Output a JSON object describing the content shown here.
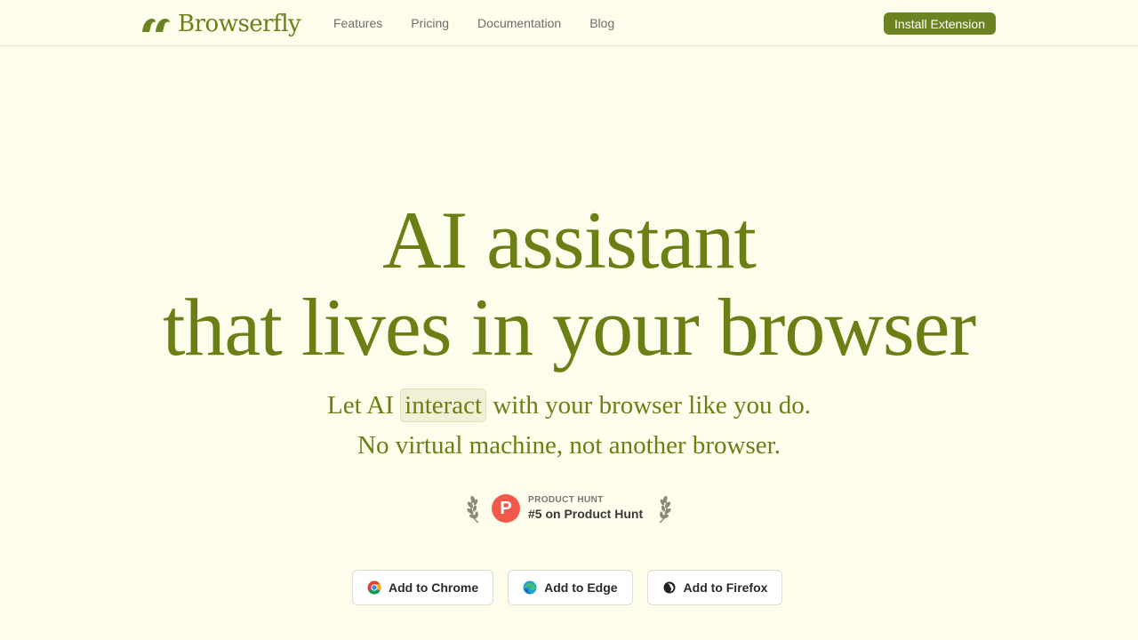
{
  "nav": {
    "brand": {
      "name": "Browserfly",
      "logo_icon": "browserfly-logo-icon"
    },
    "links": [
      {
        "label": "Features"
      },
      {
        "label": "Pricing"
      },
      {
        "label": "Documentation"
      },
      {
        "label": "Blog"
      }
    ],
    "install_label": "Install Extension"
  },
  "hero": {
    "title_line_1": "AI assistant",
    "title_line_2": "that lives in your browser",
    "subtitle_prefix": "Let AI ",
    "subtitle_highlight": "interact",
    "subtitle_suffix": " with your browser like you do.",
    "subtitle_line_2": "No virtual machine, not another browser."
  },
  "badge": {
    "logo_letter": "P",
    "kicker": "PRODUCT HUNT",
    "title": "#5 on Product Hunt"
  },
  "store_buttons": [
    {
      "label": "Add to Chrome",
      "icon": "chrome-icon"
    },
    {
      "label": "Add to Edge",
      "icon": "edge-icon"
    },
    {
      "label": "Add to Firefox",
      "icon": "firefox-icon"
    }
  ],
  "colors": {
    "background": "#fefdec",
    "brand_green": "#6b7f14",
    "button_green": "#6b8321",
    "product_hunt_red": "#f0594a"
  }
}
